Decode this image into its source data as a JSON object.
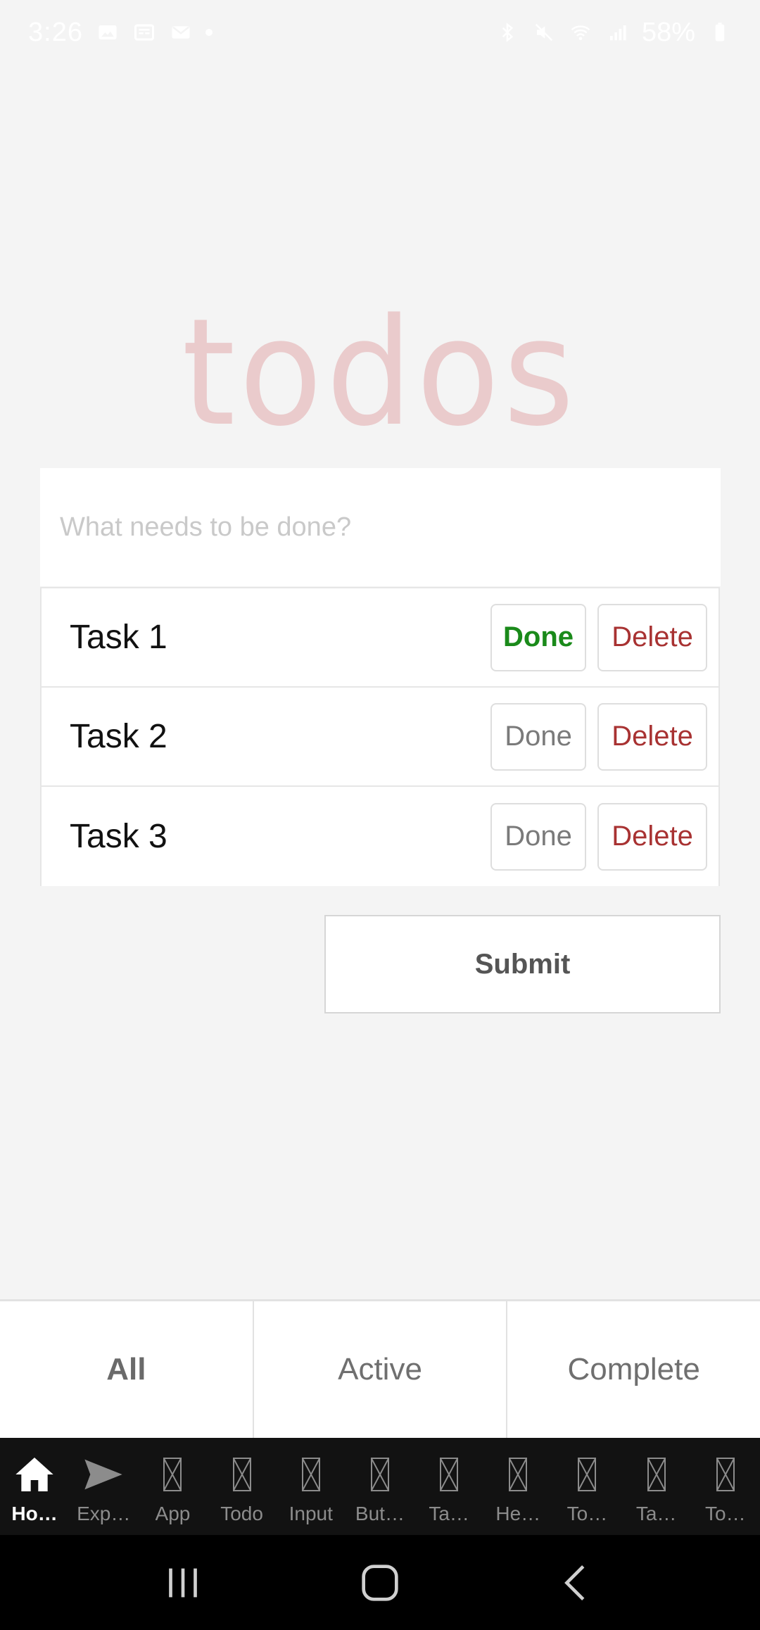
{
  "status_bar": {
    "time": "3:26",
    "battery": "58%",
    "left_icons": [
      "image-icon",
      "news-icon",
      "mail-icon",
      "dot-icon"
    ],
    "right_icons": [
      "bluetooth-icon",
      "mute-icon",
      "wifi-icon",
      "signal-icon",
      "battery-icon"
    ]
  },
  "app": {
    "title": "todos",
    "title_color": "#e8c4c5"
  },
  "new_todo": {
    "placeholder": "What needs to be done?",
    "value": ""
  },
  "todos": [
    {
      "label": "Task 1",
      "done_label": "Done",
      "delete_label": "Delete",
      "done": true
    },
    {
      "label": "Task 2",
      "done_label": "Done",
      "delete_label": "Delete",
      "done": false
    },
    {
      "label": "Task 3",
      "done_label": "Done",
      "delete_label": "Delete",
      "done": false
    }
  ],
  "submit": {
    "label": "Submit"
  },
  "filters": [
    {
      "label": "All",
      "active": true
    },
    {
      "label": "Active",
      "active": false
    },
    {
      "label": "Complete",
      "active": false
    }
  ],
  "tab_bar": {
    "items": [
      {
        "label": "Ho…",
        "icon": "home-icon",
        "active": true
      },
      {
        "label": "Exp…",
        "icon": "send-icon",
        "active": false
      },
      {
        "label": "App",
        "icon": "missing-glyph-icon",
        "active": false
      },
      {
        "label": "Todo",
        "icon": "missing-glyph-icon",
        "active": false
      },
      {
        "label": "Input",
        "icon": "missing-glyph-icon",
        "active": false
      },
      {
        "label": "But…",
        "icon": "missing-glyph-icon",
        "active": false
      },
      {
        "label": "Ta…",
        "icon": "missing-glyph-icon",
        "active": false
      },
      {
        "label": "He…",
        "icon": "missing-glyph-icon",
        "active": false
      },
      {
        "label": "To…",
        "icon": "missing-glyph-icon",
        "active": false
      },
      {
        "label": "Ta…",
        "icon": "missing-glyph-icon",
        "active": false
      },
      {
        "label": "To…",
        "icon": "missing-glyph-icon",
        "active": false
      }
    ]
  },
  "colors": {
    "background": "#f4f4f4",
    "done_active": "#1a8a1a",
    "delete": "#a83232",
    "tab_bar_bg": "#121212"
  },
  "system_nav": {
    "buttons": [
      "recents-icon",
      "home-nav-icon",
      "back-icon"
    ]
  }
}
